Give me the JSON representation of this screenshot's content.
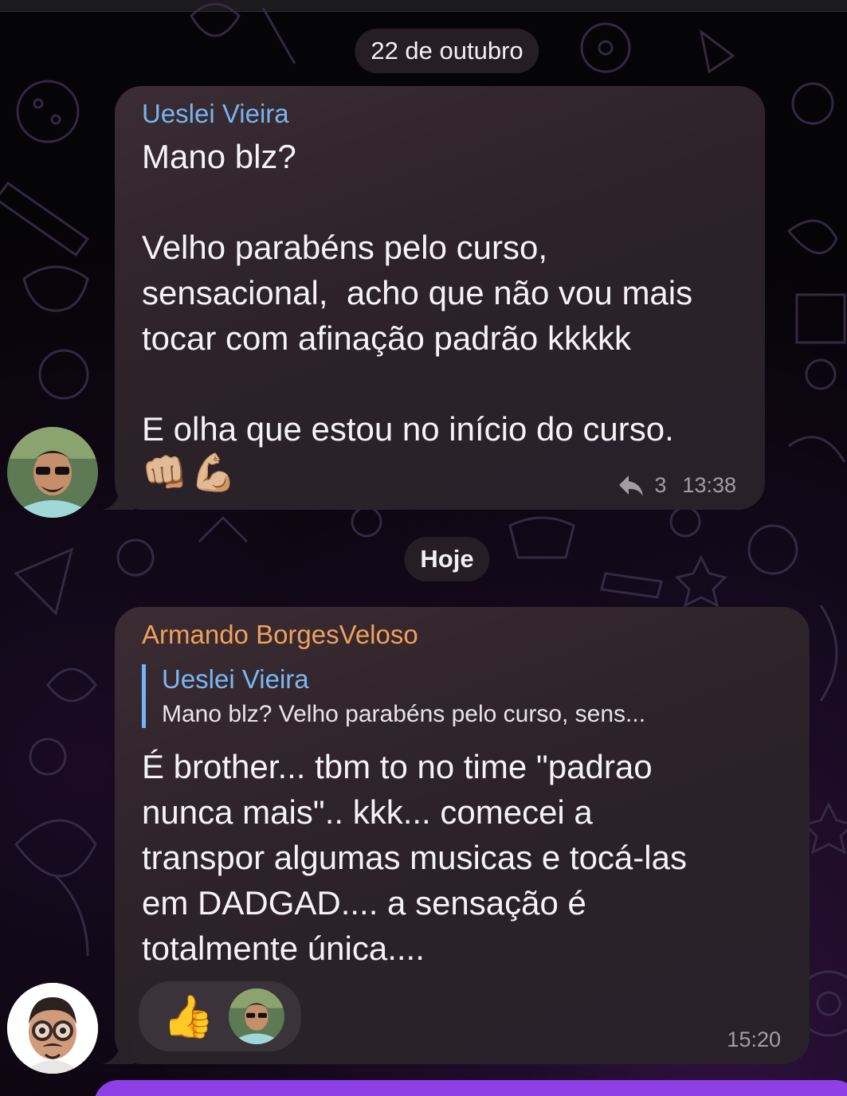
{
  "date_separators": [
    "22 de outubro",
    "Hoje"
  ],
  "messages": [
    {
      "sender": "Ueslei Vieira",
      "sender_color": "#76b4f3",
      "text": "Mano blz?\n\nVelho parabéns pelo curso,\nsensacional,  acho que não vou mais\ntocar com afinação padrão kkkkk\n\nE olha que estou no início do curso.",
      "emoji_line": "👊🏼💪🏼",
      "reply_count": "3",
      "time": "13:38",
      "reply_icon": "reply-arrow-icon"
    },
    {
      "sender": "Armando BorgesVeloso",
      "sender_color": "#f0a05c",
      "reply_to": {
        "name": "Ueslei Vieira",
        "text": "Mano blz?  Velho parabéns pelo curso, sens..."
      },
      "text": "É brother... tbm to no time \"padrao\nnunca mais\".. kkk... comecei a\ntranspor algumas musicas e tocá-las\nem DADGAD.... a sensação é\ntotalmente única....",
      "reaction_emoji": "👍",
      "time": "15:20"
    }
  ],
  "colors": {
    "bubble": "#2c2228",
    "accent_purple": "#8e3fe6",
    "reply_bar": "#6fb6ff"
  }
}
